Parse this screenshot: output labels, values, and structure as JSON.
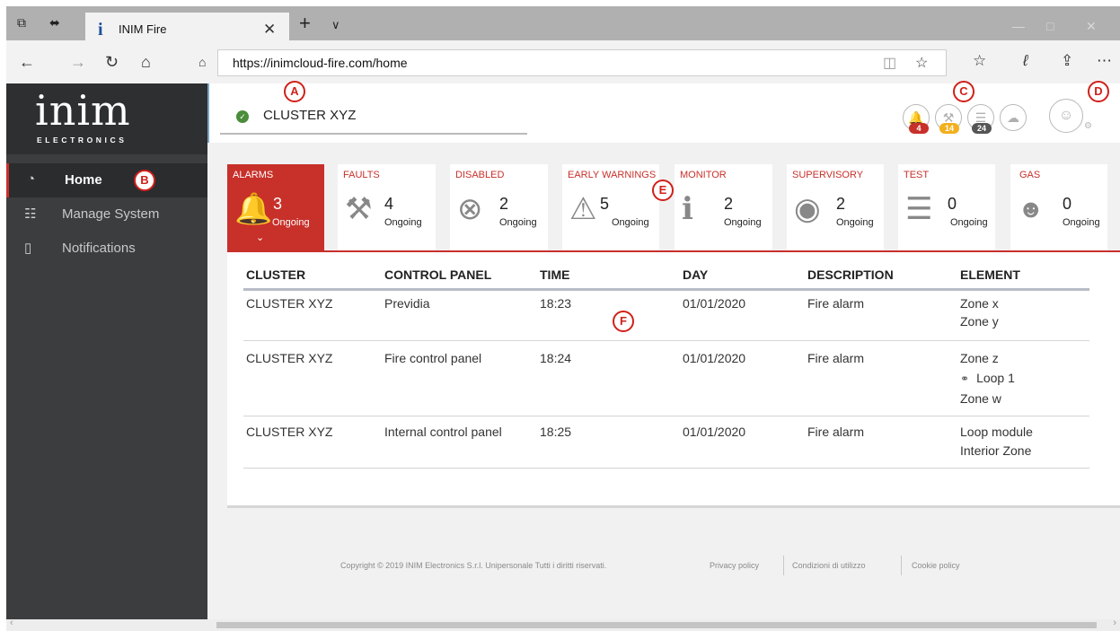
{
  "browser": {
    "tab_title": "INIM Fire",
    "tab_icon": "i",
    "url": "https://inimcloud-fire.com/home"
  },
  "sidebar": {
    "logo_text": "inim",
    "logo_subtitle": "ELECTRONICS",
    "items": [
      {
        "label": "Home",
        "icon": "dashboard-icon",
        "active": true
      },
      {
        "label": "Manage System",
        "icon": "network-icon",
        "active": false
      },
      {
        "label": "Notifications",
        "icon": "phone-icon",
        "active": false
      }
    ]
  },
  "header": {
    "cluster_name": "CLUSTER XYZ",
    "status_color": "#4a8d3a",
    "notifications": [
      {
        "icon": "bell-icon",
        "count": "4",
        "color": "#c8302a"
      },
      {
        "icon": "wrench-icon",
        "count": "14",
        "color": "#f2b01e"
      },
      {
        "icon": "list-icon",
        "count": "24",
        "color": "#555555"
      },
      {
        "icon": "cloud-icon",
        "count": "",
        "color": ""
      }
    ]
  },
  "cards": [
    {
      "title": "ALARMS",
      "count": "3",
      "status": "Ongoing",
      "icon": "bell-icon"
    },
    {
      "title": "FAULTS",
      "count": "4",
      "status": "Ongoing",
      "icon": "wrench-icon"
    },
    {
      "title": "DISABLED",
      "count": "2",
      "status": "Ongoing",
      "icon": "x-circle-icon"
    },
    {
      "title": "EARLY WARNINGS",
      "count": "5",
      "status": "Ongoing",
      "icon": "warning-icon"
    },
    {
      "title": "MONITOR",
      "count": "2",
      "status": "Ongoing",
      "icon": "info-icon"
    },
    {
      "title": "SUPERVISORY",
      "count": "2",
      "status": "Ongoing",
      "icon": "eye-icon"
    },
    {
      "title": "TEST",
      "count": "0",
      "status": "Ongoing",
      "icon": "checklist-icon"
    },
    {
      "title": "GAS",
      "count": "0",
      "status": "Ongoing",
      "icon": "gas-mask-icon"
    }
  ],
  "table": {
    "headers": [
      "CLUSTER",
      "CONTROL PANEL",
      "TIME",
      "DAY",
      "DESCRIPTION",
      "ELEMENT"
    ],
    "rows": [
      {
        "cluster": "CLUSTER XYZ",
        "panel": "Previdia",
        "time": "18:23",
        "day": "01/01/2020",
        "description": "Fire alarm",
        "element": [
          "Zone x",
          "Zone y"
        ]
      },
      {
        "cluster": "CLUSTER XYZ",
        "panel": "Fire control panel",
        "time": "18:24",
        "day": "01/01/2020",
        "description": "Fire alarm",
        "element": [
          "Zone z",
          "Loop 1",
          "Zone w"
        ]
      },
      {
        "cluster": "CLUSTER XYZ",
        "panel": "Internal control panel",
        "time": "18:25",
        "day": "01/01/2020",
        "description": "Fire alarm",
        "element": [
          "Loop module",
          "Interior Zone"
        ]
      }
    ]
  },
  "footer": {
    "copyright": "Copyright © 2019 INIM Electronics S.r.l. Unipersonale Tutti i diritti riservati.",
    "links": [
      "Privacy policy",
      "Condizioni di utilizzo",
      "Cookie policy"
    ]
  },
  "markers": [
    "A",
    "B",
    "C",
    "D",
    "E",
    "F"
  ]
}
